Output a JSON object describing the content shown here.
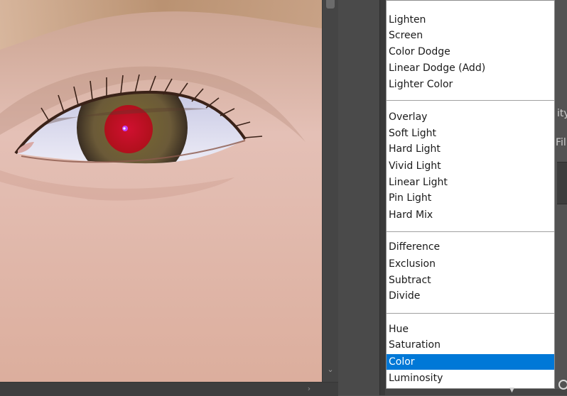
{
  "blend_menu": {
    "items": [
      {
        "label": "Lighten",
        "selected": false
      },
      {
        "label": "Screen",
        "selected": false
      },
      {
        "label": "Color Dodge",
        "selected": false
      },
      {
        "label": "Linear Dodge (Add)",
        "selected": false
      },
      {
        "label": "Lighter Color",
        "selected": false
      },
      {
        "label": "Overlay",
        "selected": false
      },
      {
        "label": "Soft Light",
        "selected": false
      },
      {
        "label": "Hard Light",
        "selected": false
      },
      {
        "label": "Vivid Light",
        "selected": false
      },
      {
        "label": "Linear Light",
        "selected": false
      },
      {
        "label": "Pin Light",
        "selected": false
      },
      {
        "label": "Hard Mix",
        "selected": false
      },
      {
        "label": "Difference",
        "selected": false
      },
      {
        "label": "Exclusion",
        "selected": false
      },
      {
        "label": "Subtract",
        "selected": false
      },
      {
        "label": "Divide",
        "selected": false
      },
      {
        "label": "Hue",
        "selected": false
      },
      {
        "label": "Saturation",
        "selected": false
      },
      {
        "label": "Color",
        "selected": true
      },
      {
        "label": "Luminosity",
        "selected": false
      }
    ]
  },
  "panel_peek": {
    "opacity_label_fragment": "ity",
    "fill_label_fragment": "Fill"
  },
  "colors": {
    "selection": "#0078d7",
    "menu_background": "#ffffff",
    "panel_background": "#535353",
    "red_eye": "#c8102e"
  },
  "icons": {
    "scroll_down": "chevron-down-icon",
    "scroll_right": "chevron-right-icon",
    "dropdown_arrow": "caret-down-icon",
    "mask": "circle-icon"
  }
}
